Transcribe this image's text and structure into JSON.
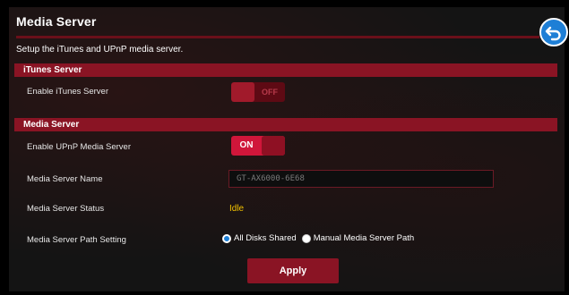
{
  "page": {
    "title": "Media Server",
    "subtitle": "Setup the iTunes and UPnP media server."
  },
  "back_button": {
    "icon": "back-arrow-icon"
  },
  "itunes_section": {
    "header": "iTunes Server",
    "enable_label": "Enable iTunes Server",
    "toggle_state": "OFF"
  },
  "media_section": {
    "header": "Media Server",
    "enable_upnp_label": "Enable UPnP Media Server",
    "upnp_toggle_state": "ON",
    "name_label": "Media Server Name",
    "name_value": "GT-AX6000-6E68",
    "status_label": "Media Server Status",
    "status_value": "Idle",
    "path_label": "Media Server Path Setting",
    "path_options": [
      "All Disks Shared",
      "Manual Media Server Path"
    ],
    "path_selected": "All Disks Shared"
  },
  "apply_label": "Apply",
  "colors": {
    "accent": "#8a1424",
    "toggle_on": "#d0163a",
    "status": "#f2c200",
    "radio_selected": "#1e7fd6"
  }
}
